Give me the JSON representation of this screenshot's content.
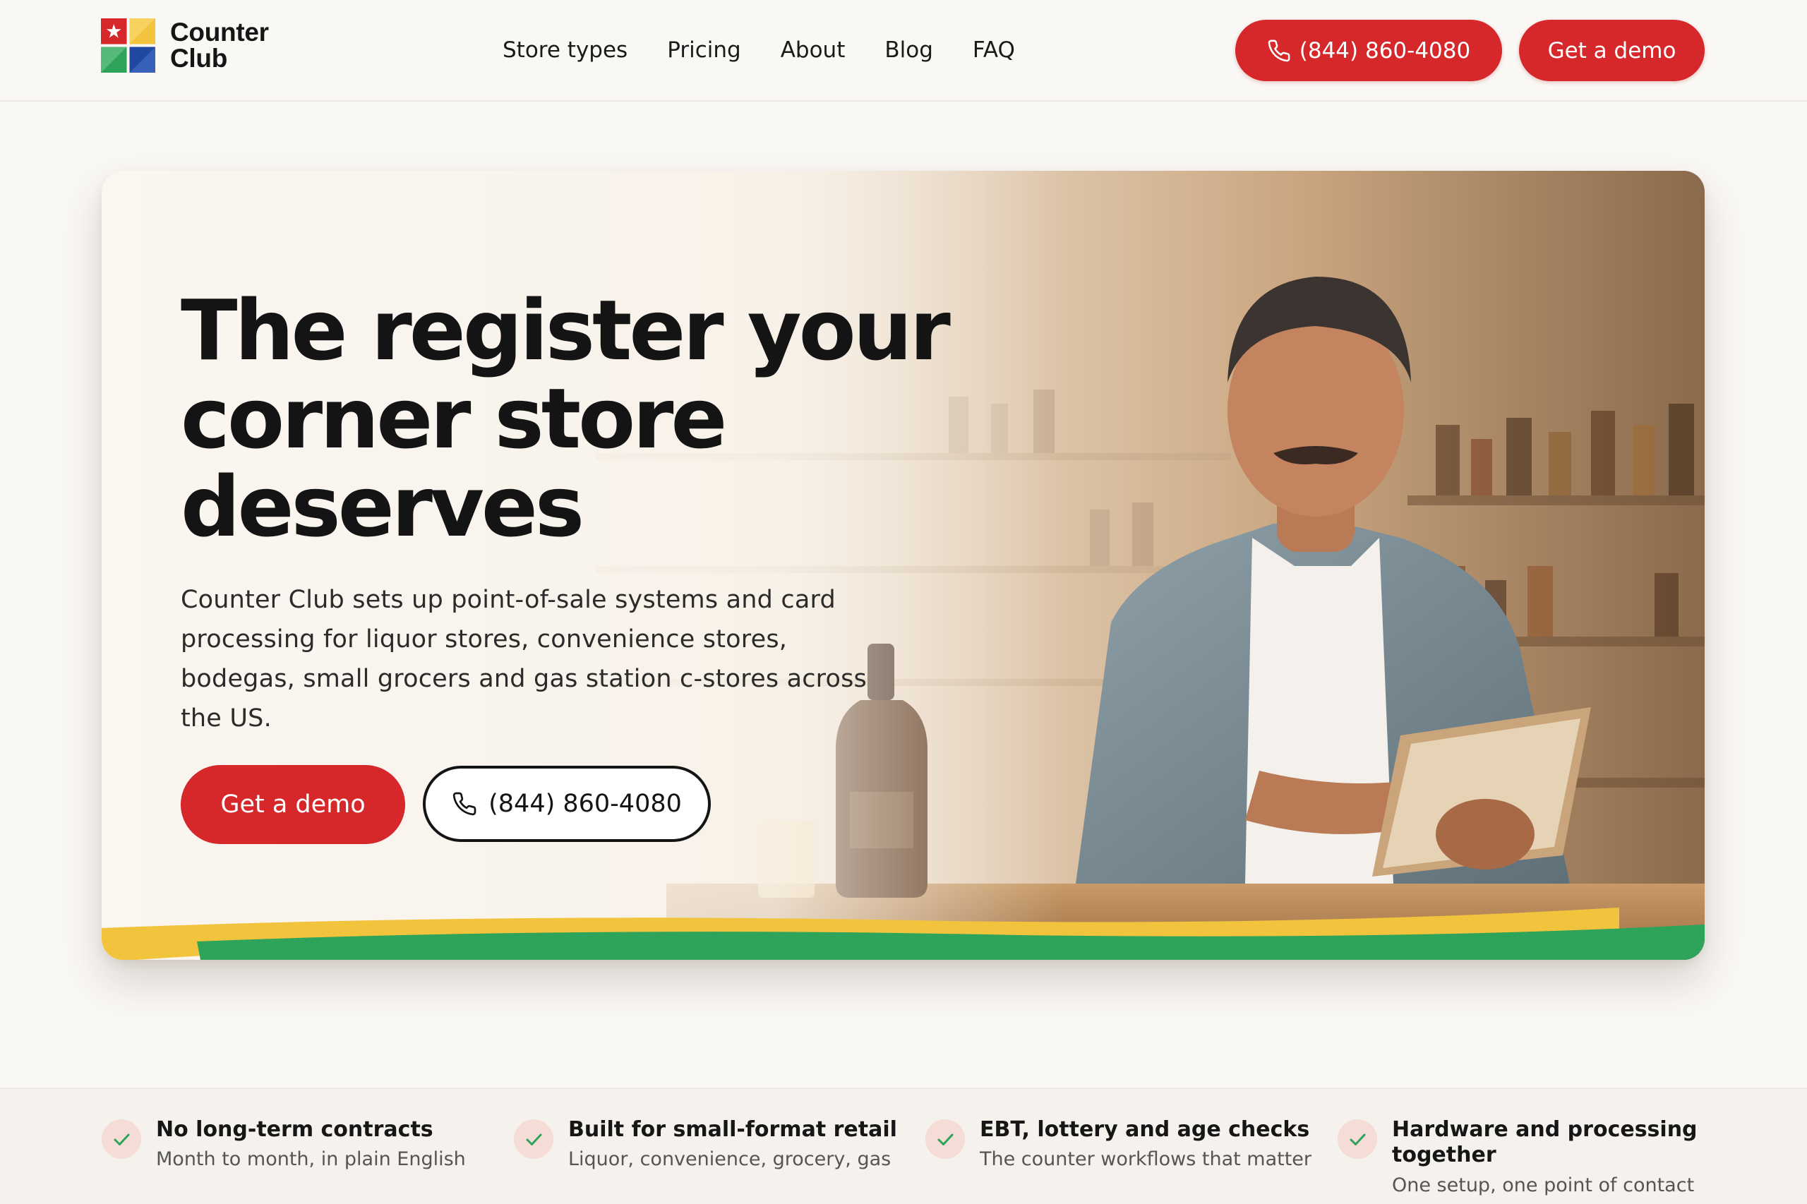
{
  "header": {
    "logo_line1": "Counter",
    "logo_line2": "Club",
    "nav": [
      "Store types",
      "Pricing",
      "About",
      "Blog",
      "FAQ"
    ],
    "phone_label": "(844) 860-4080",
    "demo_label": "Get a demo"
  },
  "hero": {
    "title_line1": "The register your",
    "title_line2": "corner store",
    "title_line3": "deserves",
    "subtitle": "Counter Club sets up point-of-sale systems and card processing for liquor stores, convenience stores, bodegas, small grocers and gas station c-stores across the US.",
    "demo_label": "Get a demo",
    "phone_label": "(844) 860-4080"
  },
  "features": [
    {
      "title": "No long-term contracts",
      "desc": "Month to month, in plain English",
      "icon": "check-icon"
    },
    {
      "title": "Built for small-format retail",
      "desc": "Liquor, convenience, grocery, gas",
      "icon": "check-icon"
    },
    {
      "title": "EBT, lottery and age checks",
      "desc": "The counter workflows that matter",
      "icon": "check-icon"
    },
    {
      "title": "Hardware and processing together",
      "desc": "One setup, one point of contact",
      "icon": "check-icon"
    }
  ],
  "colors": {
    "brand_red": "#d6272b",
    "brand_yellow": "#f2c33d",
    "brand_green": "#2ea35a",
    "brand_blue": "#2148a0",
    "background": "#faf8f5"
  }
}
